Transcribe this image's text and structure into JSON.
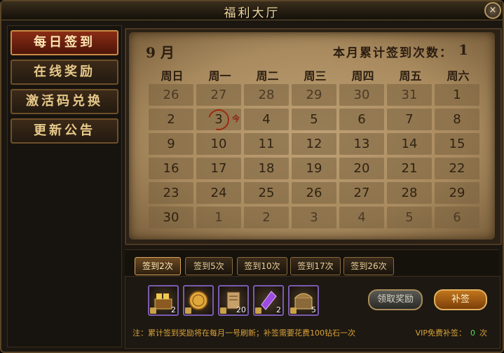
{
  "window": {
    "title": "福利大厅",
    "close": "×"
  },
  "sidebar": {
    "items": [
      {
        "label": "每日签到",
        "active": true
      },
      {
        "label": "在线奖励",
        "active": false
      },
      {
        "label": "激活码兑换",
        "active": false
      },
      {
        "label": "更新公告",
        "active": false
      }
    ]
  },
  "calendar": {
    "month_label": "9 月",
    "total_label": "本月累计签到次数：",
    "total_value": "1",
    "weekdays": [
      "周日",
      "周一",
      "周二",
      "周三",
      "周四",
      "周五",
      "周六"
    ],
    "weeks": [
      [
        "26",
        "27",
        "28",
        "29",
        "30",
        "31",
        "1"
      ],
      [
        "2",
        "3",
        "4",
        "5",
        "6",
        "7",
        "8"
      ],
      [
        "9",
        "10",
        "11",
        "12",
        "13",
        "14",
        "15"
      ],
      [
        "16",
        "17",
        "18",
        "19",
        "20",
        "21",
        "22"
      ],
      [
        "23",
        "24",
        "25",
        "26",
        "27",
        "28",
        "29"
      ],
      [
        "30",
        "1",
        "2",
        "3",
        "4",
        "5",
        "6"
      ]
    ],
    "today_tag": "今"
  },
  "tabs": [
    {
      "label": "签到2次",
      "active": true
    },
    {
      "label": "签到5次",
      "active": false
    },
    {
      "label": "签到10次",
      "active": false
    },
    {
      "label": "签到17次",
      "active": false
    },
    {
      "label": "签到26次",
      "active": false
    }
  ],
  "rewards": [
    {
      "icon": "gold-bars-chest-icon",
      "count": "2"
    },
    {
      "icon": "gold-coin-icon",
      "count": ""
    },
    {
      "icon": "scroll-book-icon",
      "count": "20"
    },
    {
      "icon": "purple-crystal-icon",
      "count": "2"
    },
    {
      "icon": "treasure-chest-icon",
      "count": "5"
    }
  ],
  "buttons": {
    "claim": "领取奖励",
    "makeup": "补签"
  },
  "note": "注：累计签到奖励将在每月一号刷新；补签需要花费100钻石一次",
  "vip": {
    "label": "VIP免费补签：",
    "value": "0",
    "unit": "次"
  },
  "colors": {
    "accent": "#c0761c",
    "parchment": "#bfa276",
    "highlight_green": "#4fe24f"
  }
}
